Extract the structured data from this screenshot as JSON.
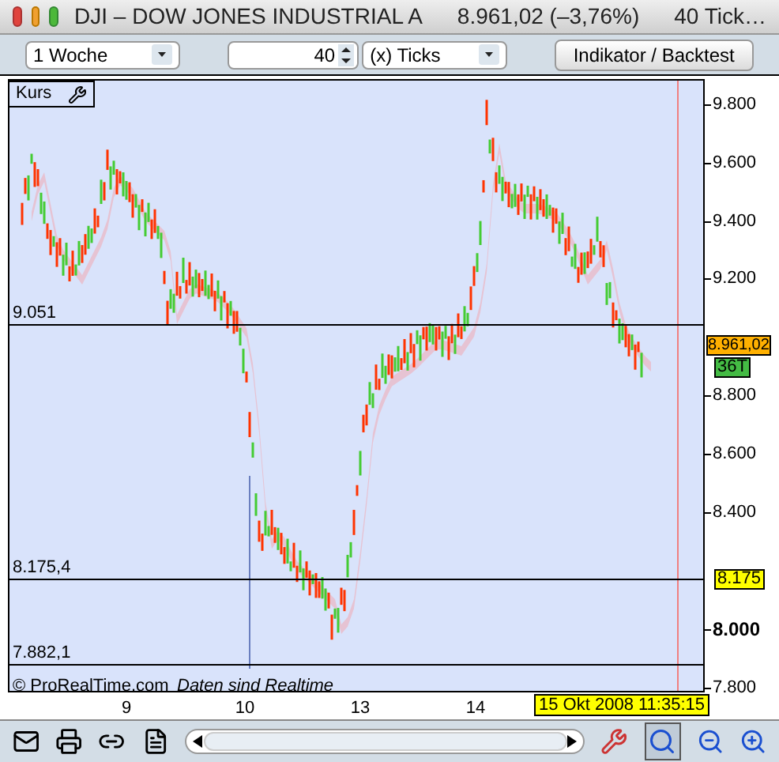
{
  "window": {
    "title": "DJI – DOW JONES INDUSTRIAL A",
    "quote": "8.961,02 (–3,76%)",
    "ticks_info": "40 Tick…"
  },
  "toolbar": {
    "period": "1 Woche",
    "count": "40",
    "unit": "(x) Ticks",
    "indicator_button": "Indikator / Backtest"
  },
  "chart": {
    "panel_label": "Kurs",
    "y_axis": [
      {
        "label": "9.800",
        "bold": false
      },
      {
        "label": "9.600",
        "bold": false
      },
      {
        "label": "9.400",
        "bold": false
      },
      {
        "label": "9.200",
        "bold": false
      },
      {
        "label": "8.800",
        "bold": false
      },
      {
        "label": "8.600",
        "bold": false
      },
      {
        "label": "8.400",
        "bold": false
      },
      {
        "label": "8.000",
        "bold": true
      },
      {
        "label": "7.800",
        "bold": false
      }
    ],
    "lines": [
      {
        "label": "9.051"
      },
      {
        "label": "8.175,4"
      },
      {
        "label": "7.882,1"
      }
    ],
    "price_tag": "8.961,02",
    "tick_tag": "36T",
    "level_tag": "8.175",
    "x_axis": [
      "9",
      "10",
      "13",
      "14"
    ],
    "copyright": "© ProRealTime.com",
    "notice": "Daten sind Realtime",
    "timestamp": "15 Okt 2008 11:35:15"
  }
}
